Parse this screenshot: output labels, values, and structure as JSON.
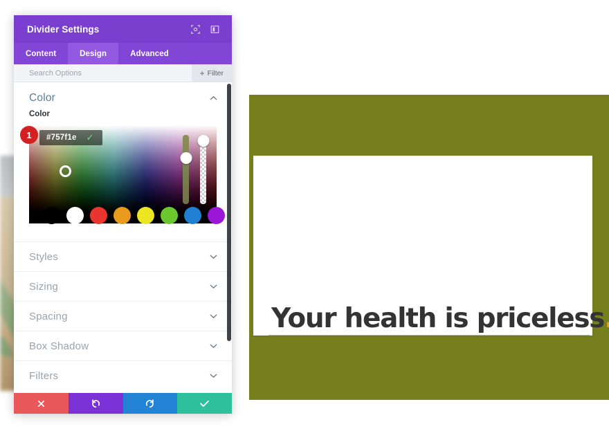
{
  "panel": {
    "title": "Divider Settings",
    "header_icons": [
      {
        "name": "focus-icon",
        "glyph": "⦿"
      },
      {
        "name": "layout-icon",
        "glyph": "▣"
      }
    ],
    "tabs": [
      {
        "label": "Content",
        "active": false
      },
      {
        "label": "Design",
        "active": true
      },
      {
        "label": "Advanced",
        "active": false
      }
    ],
    "search": {
      "placeholder": "Search Options",
      "value": ""
    },
    "filter_button": {
      "label": "Filter",
      "plus": "+"
    },
    "color_section": {
      "title": "Color",
      "collapse_chevron": "⌃",
      "field_label": "Color",
      "hex_value": "#757f1e",
      "confirm_glyph": "✓",
      "step_badge": "1",
      "swatches": [
        "#000000",
        "#ffffff",
        "#e8352e",
        "#e89a1c",
        "#ece522",
        "#6ac82e",
        "#1f7fd0",
        "#9b17d6"
      ]
    },
    "accordion": [
      {
        "label": "Styles",
        "chevron": "⌄"
      },
      {
        "label": "Sizing",
        "chevron": "⌄"
      },
      {
        "label": "Spacing",
        "chevron": "⌄"
      },
      {
        "label": "Box Shadow",
        "chevron": "⌄"
      },
      {
        "label": "Filters",
        "chevron": "⌄"
      }
    ],
    "footer": [
      {
        "name": "cancel",
        "glyph": "✖"
      },
      {
        "name": "undo",
        "glyph": "↺"
      },
      {
        "name": "redo",
        "glyph": "↻"
      },
      {
        "name": "save",
        "glyph": "✔"
      }
    ]
  },
  "preview": {
    "section_background_color": "#757f1e",
    "card_background_color": "#ffffff",
    "headline_text": "Your health is priceless",
    "headline_period": ".",
    "headline_color": "#333333",
    "period_color": "#e8a219"
  }
}
